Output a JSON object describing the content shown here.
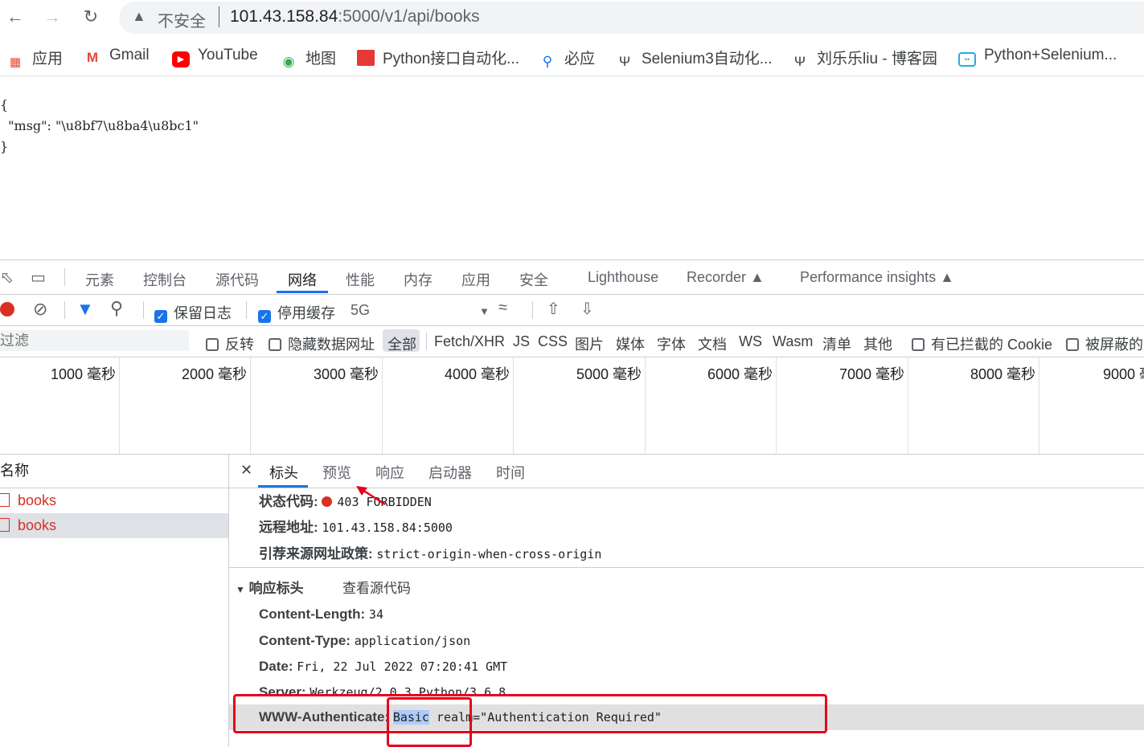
{
  "address_bar": {
    "security_label": "不安全",
    "url_host": "101.43.158.84",
    "url_rest": ":5000/v1/api/books"
  },
  "bookmarks": [
    {
      "label": "应用",
      "icon": "apps-grid-icon"
    },
    {
      "label": "Gmail",
      "icon": "gmail-icon"
    },
    {
      "label": "YouTube",
      "icon": "youtube-icon"
    },
    {
      "label": "地图",
      "icon": "maps-icon"
    },
    {
      "label": "Python接口自动化...",
      "icon": "bookmark-site-icon"
    },
    {
      "label": "必应",
      "icon": "search-icon"
    },
    {
      "label": "Selenium3自动化...",
      "icon": "cnblogs-icon"
    },
    {
      "label": "刘乐乐liu - 博客园",
      "icon": "cnblogs-icon"
    },
    {
      "label": "Python+Selenium...",
      "icon": "bilibili-icon"
    }
  ],
  "page": {
    "json_lines": [
      "{",
      "  \"msg\": \"\\u8bf7\\u8ba4\\u8bc1\"",
      "}"
    ]
  },
  "devtools": {
    "tabs": [
      "元素",
      "控制台",
      "源代码",
      "网络",
      "性能",
      "内存",
      "应用",
      "安全",
      "Lighthouse",
      "Recorder",
      "Performance insights"
    ],
    "active_tab": "网络",
    "toolbar": {
      "preserve_log": "保留日志",
      "disable_cache": "停用缓存",
      "throttle": "5G"
    },
    "filter": {
      "placeholder": "过滤",
      "invert": "反转",
      "hide_data_urls": "隐藏数据网址",
      "types": [
        "全部",
        "Fetch/XHR",
        "JS",
        "CSS",
        "图片",
        "媒体",
        "字体",
        "文档",
        "WS",
        "Wasm",
        "清单",
        "其他"
      ],
      "blocked_cookies": "有已拦截的 Cookie",
      "blocked_requests": "被屏蔽的"
    },
    "timeline_labels": [
      "1000 毫秒",
      "2000 毫秒",
      "3000 毫秒",
      "4000 毫秒",
      "5000 毫秒",
      "6000 毫秒",
      "7000 毫秒",
      "8000 毫秒",
      "9000 毫"
    ],
    "requests": {
      "header": "名称",
      "rows": [
        "books",
        "books"
      ]
    },
    "detail": {
      "tabs": [
        "标头",
        "预览",
        "响应",
        "启动器",
        "时间"
      ],
      "active_tab": "标头",
      "general": {
        "status_key": "状态代码:",
        "status_value": "403 FORBIDDEN",
        "remote_key": "远程地址:",
        "remote_value": "101.43.158.84:5000",
        "referrer_key": "引荐来源网址政策:",
        "referrer_value": "strict-origin-when-cross-origin"
      },
      "response_headers": {
        "title": "响应标头",
        "view_source": "查看源代码",
        "items": [
          {
            "key": "Content-Length:",
            "value": "34"
          },
          {
            "key": "Content-Type:",
            "value": "application/json"
          },
          {
            "key": "Date:",
            "value": "Fri, 22 Jul 2022 07:20:41 GMT"
          },
          {
            "key": "Server:",
            "value": "Werkzeug/2.0.3 Python/3.6.8"
          },
          {
            "key": "WWW-Authenticate:",
            "value_highlight": "Basic",
            "value_rest": " realm=\"Authentication Required\""
          }
        ]
      }
    }
  },
  "colors": {
    "accent": "#1a73e8",
    "annotation_red": "#e8001c",
    "error_red": "#d93025"
  }
}
